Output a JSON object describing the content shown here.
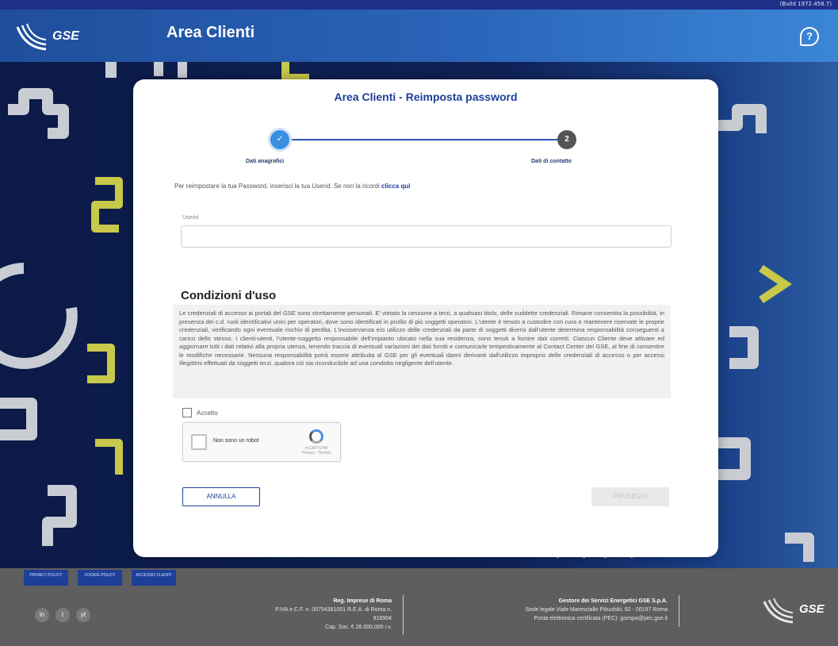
{
  "topbar": {
    "version": "(Build 1972.458.7)"
  },
  "header": {
    "logo": "GSE",
    "title": "Area Clienti",
    "help_icon": "help-icon"
  },
  "card": {
    "title": "Area Clienti - Reimposta password",
    "steps": [
      {
        "label": "Dati anagrafici",
        "symbol": "✓"
      },
      {
        "label": "Dati di contatto",
        "symbol": "2"
      }
    ],
    "intro_text": "Per reimpostare la tua Password, inserisci la tua Userid. Se non la ricordi",
    "intro_link": "clicca qui",
    "userid_label": "Userid",
    "userid_value": "",
    "terms_title": "Condizioni d'uso",
    "terms_text": "Le credenziali di accesso ai portali del GSE sono strettamente personali. E' vietato la cessione a terzi, a qualsiasi titolo, delle suddette credenziali. Rimane consentita la possibilità, in presenza dei c.d. ruoli identificativi unici per operatori, dove sono identificati in profilo di più soggetti operatori. L'utente è tenuto a custodire con cura e mantenere riservate le proprie credenziali, verificando ogni eventuale rischio di perdita. L'inosservanza e/o utilizzo delle credenziali da parte di soggetti diversi dall'utente determina responsabilità conseguenti a carico dello stesso. I clienti-utenti, l'utente-soggetto responsabile dell'impianto ubicato nella sua residenza, sono tenuti a fornire dati corretti. Ciascun Cliente deve attivare ed aggiornare tutti i dati relativi alla propria utenza, tenendo traccia di eventuali variazioni dei dati forniti e comunicarle tempestivamente al Contact Center del GSE, al fine di consentire le modifiche necessarie. Nessuna responsabilità potrà essere attribuita al GSE per gli eventuali danni derivanti dall'utilizzo improprio delle credenziali di accesso o per accessi illegittimi effettuati da soggetti terzi, qualora ciò sia riconducibile ad una condotta negligente dell'utente.",
    "accept_label": "Accetto",
    "recaptcha_label": "Non sono un robot",
    "recaptcha_small": "reCAPTCHA Privacy - Termini",
    "cancel_label": "ANNULLA",
    "proceed_label": "PROSEGUI"
  },
  "footer": {
    "nav": [
      "PRIVACY POLICY",
      "COOKIE POLICY",
      "ACCESSO CLIENTI"
    ],
    "social": [
      "in",
      "t",
      "yt"
    ],
    "reg_title": "Reg. Imprese di Roma",
    "reg_lines": [
      "P.IVA e C.F. n. 05754381001 R.E.A. di Roma n.",
      "918904",
      "Cap. Soc. € 26.000.000 i.v."
    ],
    "gse_title": "Gestore dei Servizi Energetici GSE S.p.A.",
    "gse_lines": [
      "Sede legale Viale Maresciallo Pilsudski, 92 - 00197 Roma",
      "Posta elettronica certificata (PEC): gsespa@pec.gse.it"
    ],
    "logo": "GSE"
  }
}
